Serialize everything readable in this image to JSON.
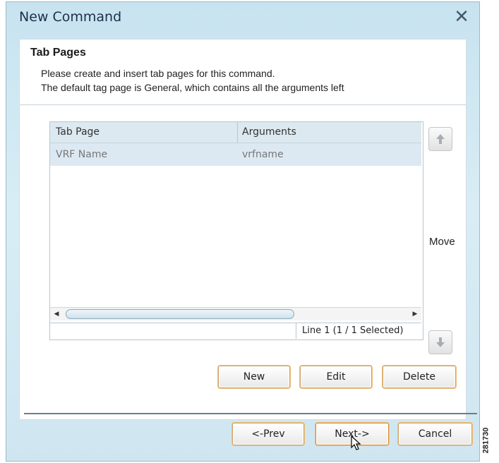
{
  "window": {
    "title": "New Command",
    "close_glyph": "✕"
  },
  "section": {
    "heading": "Tab Pages",
    "description_line1": "Please create and insert tab pages for this command.",
    "description_line2": "The default tag page is General, which contains all the arguments left"
  },
  "grid": {
    "columns": [
      "Tab Page",
      "Arguments"
    ],
    "rows": [
      {
        "tab_page": "VRF Name",
        "arguments": "vrfname"
      }
    ],
    "status": "Line 1 (1 / 1 Selected)"
  },
  "move": {
    "label": "Move",
    "up_icon": "arrow-up-icon",
    "down_icon": "arrow-down-icon"
  },
  "actions": {
    "new_label": "New",
    "edit_label": "Edit",
    "delete_label": "Delete"
  },
  "footer": {
    "prev_label": "<-Prev",
    "next_label": "Next->",
    "cancel_label": "Cancel"
  },
  "side_label": "281730",
  "colors": {
    "button_border": "#c9a26a",
    "selected_row": "#dde9f2",
    "header_bg": "#dce9f0"
  }
}
